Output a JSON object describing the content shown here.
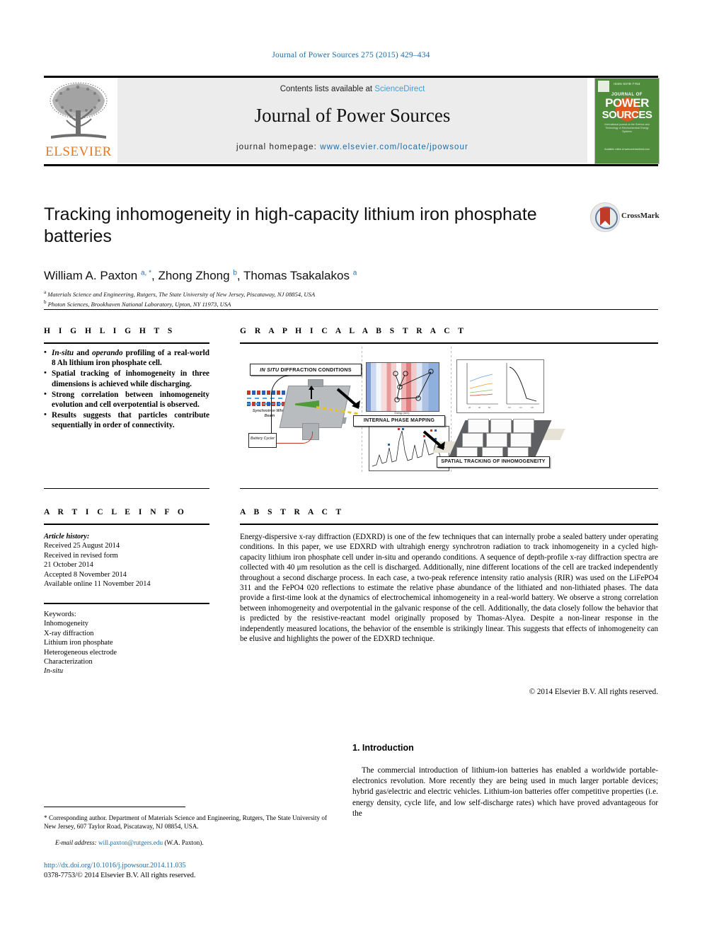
{
  "running_head": "Journal of Power Sources 275 (2015) 429–434",
  "masthead": {
    "contents_prefix": "Contents lists available at ",
    "sciencedirect": "ScienceDirect",
    "journal_title": "Journal of Power Sources",
    "homepage_prefix": "journal homepage: ",
    "homepage_url": "www.elsevier.com/locate/jpowsour",
    "publisher": "ELSEVIER",
    "cover": {
      "top_line": "ISSN 0378-7753",
      "journal_of": "JOURNAL OF",
      "power": "POWER",
      "sources": "SOURCES",
      "subtitle": "International journal on the Science and Technology of Electrochemical Energy Systems",
      "bottom": "Available online at www.sciencedirect.com"
    }
  },
  "article": {
    "title": "Tracking inhomogeneity in high-capacity lithium iron phosphate batteries",
    "crossmark_label": "CrossMark",
    "authors_html": "William A. Paxton <sup>a, *</sup>, Zhong Zhong <sup>b</sup>, Thomas Tsakalakos <sup>a</sup>",
    "affiliation_a": "Materials Science and Engineering, Rutgers, The State University of New Jersey, Piscataway, NJ 08854, USA",
    "affiliation_b": "Photon Sciences, Brookhaven National Laboratory, Upton, NY 11973, USA"
  },
  "sections": {
    "highlights": "H I G H L I G H T S",
    "graphical_abstract": "G R A P H I C A L   A B S T R A C T",
    "article_info": "A R T I C L E   I N F O",
    "abstract": "A B S T R A C T"
  },
  "highlights": [
    "In-situ and operando profiling of a real-world 8 Ah lithium iron phosphate cell.",
    "Spatial tracking of inhomogeneity in three dimensions is achieved while discharging.",
    "Strong correlation between inhomogeneity evolution and cell overpotential is observed.",
    "Results suggests that particles contribute sequentially in order of connectivity."
  ],
  "graphical_abstract_figure": {
    "label_diffraction": "IN SITU DIFFRACTION CONDITIONS",
    "label_phase_mapping": "INTERNAL PHASE MAPPING",
    "label_spatial": "SPATIAL TRACKING OF INHOMOGENEITY",
    "synchrotron_caption": "Synchrotron White Beam",
    "cycler_caption": "Battery Cycler"
  },
  "article_info": {
    "history_label": "Article history:",
    "history": [
      "Received 25 August 2014",
      "Received in revised form",
      "21 October 2014",
      "Accepted 8 November 2014",
      "Available online 11 November 2014"
    ],
    "keywords_label": "Keywords:",
    "keywords": [
      "Inhomogeneity",
      "X-ray diffraction",
      "Lithium iron phosphate",
      "Heterogeneous electrode",
      "Characterization",
      "In-situ"
    ]
  },
  "abstract": {
    "text": "Energy-dispersive x-ray diffraction (EDXRD) is one of the few techniques that can internally probe a sealed battery under operating conditions. In this paper, we use EDXRD with ultrahigh energy synchrotron radiation to track inhomogeneity in a cycled high-capacity lithium iron phosphate cell under in-situ and operando conditions. A sequence of depth-profile x-ray diffraction spectra are collected with 40 μm resolution as the cell is discharged. Additionally, nine different locations of the cell are tracked independently throughout a second discharge process. In each case, a two-peak reference intensity ratio analysis (RIR) was used on the LiFePO4 311 and the FePO4 020 reflections to estimate the relative phase abundance of the lithiated and non-lithiated phases. The data provide a first-time look at the dynamics of electrochemical inhomogeneity in a real-world battery. We observe a strong correlation between inhomogeneity and overpotential in the galvanic response of the cell. Additionally, the data closely follow the behavior that is predicted by the resistive-reactant model originally proposed by Thomas-Alyea. Despite a non-linear response in the independently measured locations, the behavior of the ensemble is strikingly linear. This suggests that effects of inhomogeneity can be elusive and highlights the power of the EDXRD technique.",
    "copyright": "© 2014 Elsevier B.V. All rights reserved."
  },
  "introduction": {
    "heading": "1.  Introduction",
    "paragraph": "The commercial introduction of lithium-ion batteries has enabled a worldwide portable-electronics revolution. More recently they are being used in much larger portable devices; hybrid gas/electric and electric vehicles. Lithium-ion batteries offer competitive properties (i.e. energy density, cycle life, and low self-discharge rates) which have proved advantageous for the"
  },
  "footer": {
    "corresponding": "* Corresponding author. Department of Materials Science and Engineering, Rutgers, The State University of New Jersey, 607 Taylor Road, Piscataway, NJ 08854, USA.",
    "email_label": "E-mail address:",
    "email": "will.paxton@rutgers.edu",
    "email_suffix": "(W.A. Paxton).",
    "doi": "http://dx.doi.org/10.1016/j.jpowsour.2014.11.035",
    "issn_line": "0378-7753/© 2014 Elsevier B.V. All rights reserved."
  },
  "colors": {
    "link_blue": "#1a6ca8",
    "sciencedirect_blue": "#3f9fd6",
    "elsevier_orange": "#E87722",
    "cover_green": "#4f8c3b",
    "crossmark_red": "#c0392b"
  }
}
